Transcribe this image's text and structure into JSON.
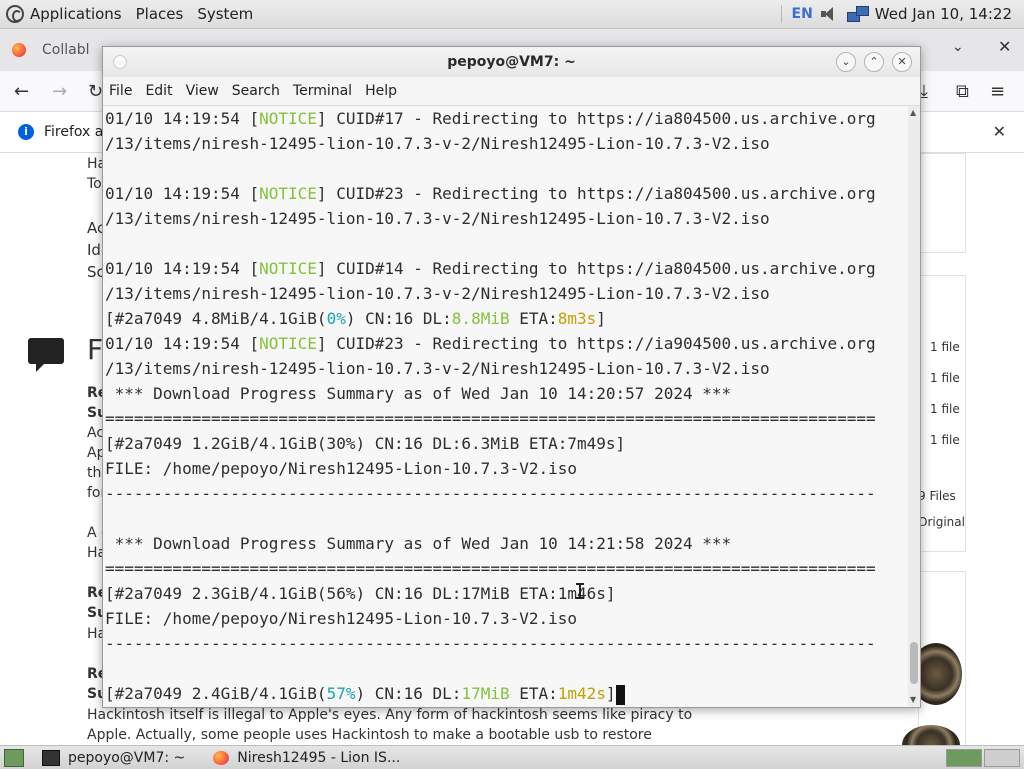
{
  "top_panel": {
    "menus": [
      "Applications",
      "Places",
      "System"
    ],
    "lang": "EN",
    "clock": "Wed Jan 10, 14:22"
  },
  "firefox": {
    "tab_label": "Collabl",
    "notice_text": "Firefox a",
    "page_fragments": {
      "a": "Ha",
      "b": "To",
      "c": "Ac",
      "d": "Ide",
      "e": "Sc",
      "big_f": "F",
      "re1": "Re",
      "su1": "Su",
      "ac2": "Ac",
      "ap": "Ap",
      "the": "the",
      "for": "for",
      "a2": "A c",
      "ha2": "Ha",
      "re2": "Re",
      "su2": "Su",
      "ha3": "Ha",
      "re3": "Re",
      "su3": "Su",
      "para1": "Hackintosh itself is illegal to Apple's eyes. Any form of hackintosh seems like piracy to",
      "para2": "Apple. Actually, some people uses Hackintosh to make a bootable usb to restore"
    },
    "files": [
      "1 file",
      "1 file",
      "1 file",
      "1 file"
    ],
    "files_total": "9 Files",
    "original": "Original"
  },
  "terminal": {
    "title": "pepoyo@VM7: ~",
    "menu": [
      "File",
      "Edit",
      "View",
      "Search",
      "Terminal",
      "Help"
    ],
    "notice_word": "NOTICE",
    "lines": [
      {
        "pre": "01/10 14:19:54 [",
        "post": "] CUID#17 - Redirecting to https://ia804500.us.archive.org"
      },
      {
        "text": "/13/items/niresh-12495-lion-10.7.3-v-2/Niresh12495-Lion-10.7.3-V2.iso"
      },
      {
        "text": ""
      },
      {
        "pre": "01/10 14:19:54 [",
        "post": "] CUID#23 - Redirecting to https://ia804500.us.archive.org"
      },
      {
        "text": "/13/items/niresh-12495-lion-10.7.3-v-2/Niresh12495-Lion-10.7.3-V2.iso"
      },
      {
        "text": ""
      },
      {
        "pre": "01/10 14:19:54 [",
        "post": "] CUID#14 - Redirecting to https://ia804500.us.archive.org"
      },
      {
        "text": "/13/items/niresh-12495-lion-10.7.3-v-2/Niresh12495-Lion-10.7.3-V2.iso"
      },
      {
        "prog": true,
        "a": "[#2a7049 4.8MiB/4.1GiB(",
        "pct": "0%",
        "b": ") CN:16 DL:",
        "dl": "8.8MiB",
        "c": " ETA:",
        "eta": "8m3s",
        "d": "]"
      },
      {
        "pre": "01/10 14:19:54 [",
        "post": "] CUID#23 - Redirecting to https://ia904500.us.archive.org"
      },
      {
        "text": "/13/items/niresh-12495-lion-10.7.3-v-2/Niresh12495-Lion-10.7.3-V2.iso"
      },
      {
        "text": " *** Download Progress Summary as of Wed Jan 10 14:20:57 2024 ***"
      },
      {
        "text": "================================================================================"
      },
      {
        "text": "[#2a7049 1.2GiB/4.1GiB(30%) CN:16 DL:6.3MiB ETA:7m49s]"
      },
      {
        "text": "FILE: /home/pepoyo/Niresh12495-Lion-10.7.3-V2.iso"
      },
      {
        "text": "--------------------------------------------------------------------------------"
      },
      {
        "text": ""
      },
      {
        "text": " *** Download Progress Summary as of Wed Jan 10 14:21:58 2024 ***"
      },
      {
        "text": "================================================================================"
      },
      {
        "text": "[#2a7049 2.3GiB/4.1GiB(56%) CN:16 DL:17MiB ETA:1m46s]"
      },
      {
        "text": "FILE: /home/pepoyo/Niresh12495-Lion-10.7.3-V2.iso"
      },
      {
        "text": "--------------------------------------------------------------------------------"
      },
      {
        "text": ""
      },
      {
        "prog": true,
        "cursor": true,
        "a": "[#2a7049 2.4GiB/4.1GiB(",
        "pct": "57%",
        "b": ") CN:16 DL:",
        "dl": "17MiB",
        "c": " ETA:",
        "eta": "1m42s",
        "d": "]"
      }
    ]
  },
  "bottom_panel": {
    "tasks": [
      "pepoyo@VM7: ~",
      "Niresh12495 - Lion IS..."
    ]
  },
  "colors": {
    "notice": "#84c23d",
    "percent": "#16a6b0",
    "download_rate": "#84c23d",
    "eta": "#c4a000"
  }
}
